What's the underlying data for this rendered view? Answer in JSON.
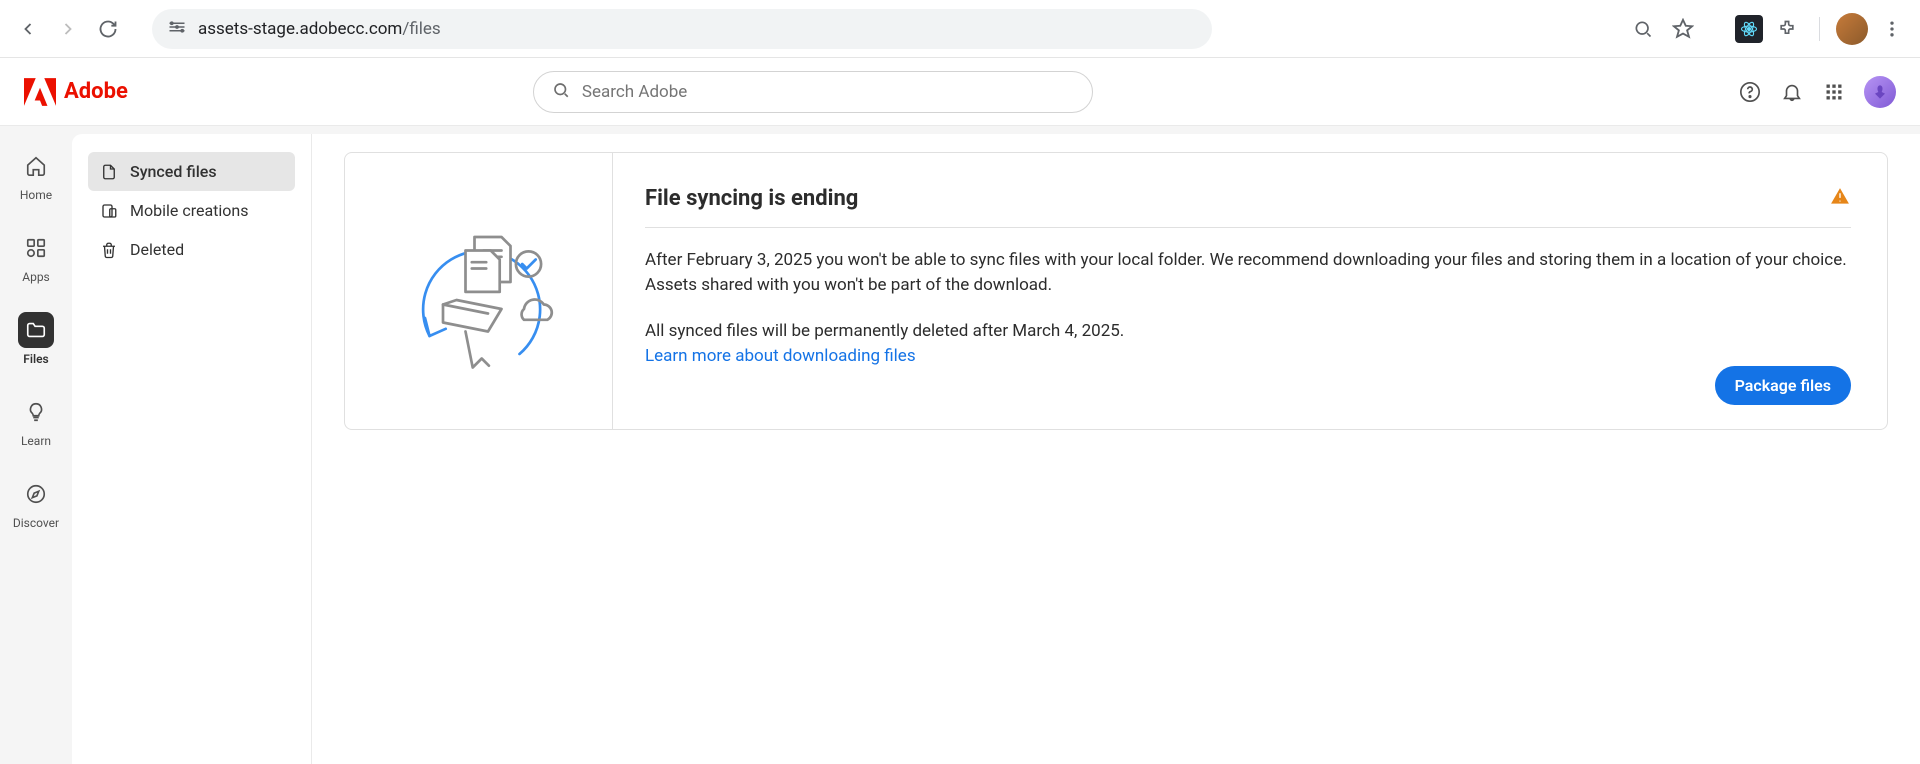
{
  "browser": {
    "url_host": "assets-stage.adobecc.com",
    "url_path": "/files"
  },
  "header": {
    "brand": "Adobe",
    "search_placeholder": "Search Adobe"
  },
  "left_rail": {
    "items": [
      {
        "label": "Home"
      },
      {
        "label": "Apps"
      },
      {
        "label": "Files"
      },
      {
        "label": "Learn"
      },
      {
        "label": "Discover"
      }
    ]
  },
  "sub_nav": {
    "items": [
      {
        "label": "Synced files"
      },
      {
        "label": "Mobile creations"
      },
      {
        "label": "Deleted"
      }
    ]
  },
  "notice": {
    "title": "File syncing is ending",
    "paragraph1": "After February 3, 2025 you won't be able to sync files with your local folder. We recommend downloading your files and storing them in a location of your choice. Assets shared with you won't be part of the download.",
    "paragraph2": "All synced files will be permanently deleted after March 4, 2025.",
    "link_text": "Learn more about downloading files",
    "cta": "Package files"
  }
}
